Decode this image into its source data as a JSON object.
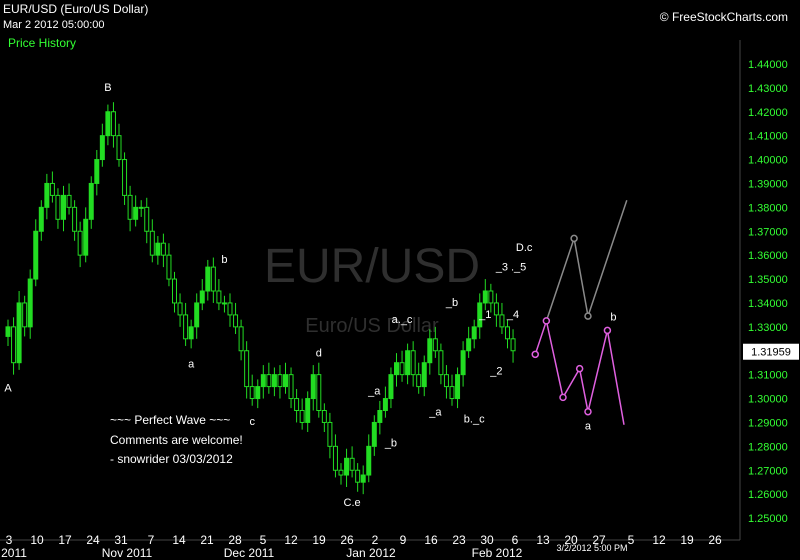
{
  "header": {
    "title": "EUR/USD (Euro/US Dollar)",
    "datetime": "Mar 2 2012 05:00:00",
    "panel_label": "Price History",
    "credit": "© FreeStockCharts.com"
  },
  "watermark": {
    "symbol": "EUR/USD",
    "name": "Euro/US Dollar"
  },
  "comment": {
    "line1": "~~~ Perfect Wave ~~~",
    "line2": "Comments are welcome!",
    "line3": "- snowrider  03/03/2012"
  },
  "colors": {
    "bullish": "#22dd22",
    "projection_down": "#e060e0",
    "projection_up": "#8a8a8a",
    "axis_text": "#33ff33",
    "last_price_box": "#ffffff"
  },
  "chart_data": {
    "type": "candlestick",
    "ylim": [
      1.245,
      1.445
    ],
    "y_ticks": [
      "1.44000",
      "1.43000",
      "1.42000",
      "1.41000",
      "1.40000",
      "1.39000",
      "1.38000",
      "1.37000",
      "1.36000",
      "1.35000",
      "1.34000",
      "1.33000",
      "1.32000",
      "1.31000",
      "1.30000",
      "1.29000",
      "1.28000",
      "1.27000",
      "1.26000",
      "1.25000"
    ],
    "x_ticks": [
      "3",
      "10",
      "17",
      "24",
      "31",
      "7",
      "14",
      "21",
      "28",
      "5",
      "12",
      "19",
      "26",
      "2",
      "9",
      "16",
      "23",
      "30",
      "6",
      "13",
      "20",
      "27",
      "5",
      "12",
      "19",
      "26"
    ],
    "x_month_labels": [
      "2011",
      "Nov 2011",
      "Dec 2011",
      "Jan 2012",
      "Feb 2012"
    ],
    "cursor_label": "3/2/2012 5:00 PM",
    "last_price": "1.31959",
    "closes": [
      1.33,
      1.315,
      1.34,
      1.33,
      1.35,
      1.37,
      1.38,
      1.39,
      1.385,
      1.375,
      1.385,
      1.38,
      1.37,
      1.36,
      1.375,
      1.39,
      1.4,
      1.41,
      1.42,
      1.41,
      1.4,
      1.385,
      1.375,
      1.38,
      1.38,
      1.37,
      1.36,
      1.365,
      1.36,
      1.35,
      1.34,
      1.335,
      1.325,
      1.33,
      1.34,
      1.345,
      1.355,
      1.345,
      1.34,
      1.34,
      1.335,
      1.33,
      1.32,
      1.305,
      1.3,
      1.305,
      1.31,
      1.305,
      1.31,
      1.305,
      1.31,
      1.3,
      1.295,
      1.29,
      1.3,
      1.31,
      1.295,
      1.29,
      1.28,
      1.27,
      1.268,
      1.275,
      1.27,
      1.265,
      1.268,
      1.28,
      1.29,
      1.295,
      1.3,
      1.31,
      1.315,
      1.31,
      1.32,
      1.31,
      1.305,
      1.315,
      1.325,
      1.32,
      1.31,
      1.305,
      1.3,
      1.31,
      1.32,
      1.325,
      1.33,
      1.34,
      1.345,
      1.34,
      1.335,
      1.33,
      1.325,
      1.32
    ],
    "wave_labels": [
      {
        "label": "A",
        "x": 0,
        "y": 1.308,
        "pos": "below"
      },
      {
        "label": "B",
        "x": 18,
        "y": 1.427,
        "pos": "above"
      },
      {
        "label": "a",
        "x": 33,
        "y": 1.318,
        "pos": "below"
      },
      {
        "label": "b",
        "x": 39,
        "y": 1.355,
        "pos": "above"
      },
      {
        "label": "c",
        "x": 44,
        "y": 1.294,
        "pos": "below"
      },
      {
        "label": "d",
        "x": 56,
        "y": 1.316,
        "pos": "above"
      },
      {
        "label": "_a",
        "x": 66,
        "y": 1.3,
        "pos": "above"
      },
      {
        "label": "C.e",
        "x": 62,
        "y": 1.26,
        "pos": "below"
      },
      {
        "label": "_b",
        "x": 69,
        "y": 1.285,
        "pos": "below"
      },
      {
        "label": "a._c",
        "x": 71,
        "y": 1.33,
        "pos": "above"
      },
      {
        "label": "_a",
        "x": 77,
        "y": 1.298,
        "pos": "below"
      },
      {
        "label": "_b",
        "x": 80,
        "y": 1.337,
        "pos": "above"
      },
      {
        "label": "b._c",
        "x": 84,
        "y": 1.295,
        "pos": "below"
      },
      {
        "label": "_1",
        "x": 86,
        "y": 1.332,
        "pos": "above"
      },
      {
        "label": "_2",
        "x": 88,
        "y": 1.315,
        "pos": "below"
      },
      {
        "label": "_3",
        "x": 89,
        "y": 1.352,
        "pos": "above"
      },
      {
        "label": "_4",
        "x": 91,
        "y": 1.332,
        "pos": "above"
      },
      {
        "label": "._5",
        "x": 92,
        "y": 1.352,
        "pos": "above"
      },
      {
        "label": "D.c",
        "x": 93,
        "y": 1.36,
        "pos": "above"
      }
    ],
    "projection_down": [
      {
        "x": 95,
        "y": 1.3185,
        "label": ""
      },
      {
        "x": 97,
        "y": 1.3325,
        "label": ""
      },
      {
        "x": 100,
        "y": 1.3005,
        "label": ""
      },
      {
        "x": 103,
        "y": 1.3125,
        "label": ""
      },
      {
        "x": 104.5,
        "y": 1.2945,
        "label": "a"
      },
      {
        "x": 108,
        "y": 1.3285,
        "label": "b"
      },
      {
        "x": 111,
        "y": 1.289,
        "label": ""
      }
    ],
    "projection_up": [
      {
        "x": 97,
        "y": 1.3325
      },
      {
        "x": 102,
        "y": 1.367
      },
      {
        "x": 104.5,
        "y": 1.3345
      },
      {
        "x": 111.5,
        "y": 1.383
      }
    ]
  }
}
